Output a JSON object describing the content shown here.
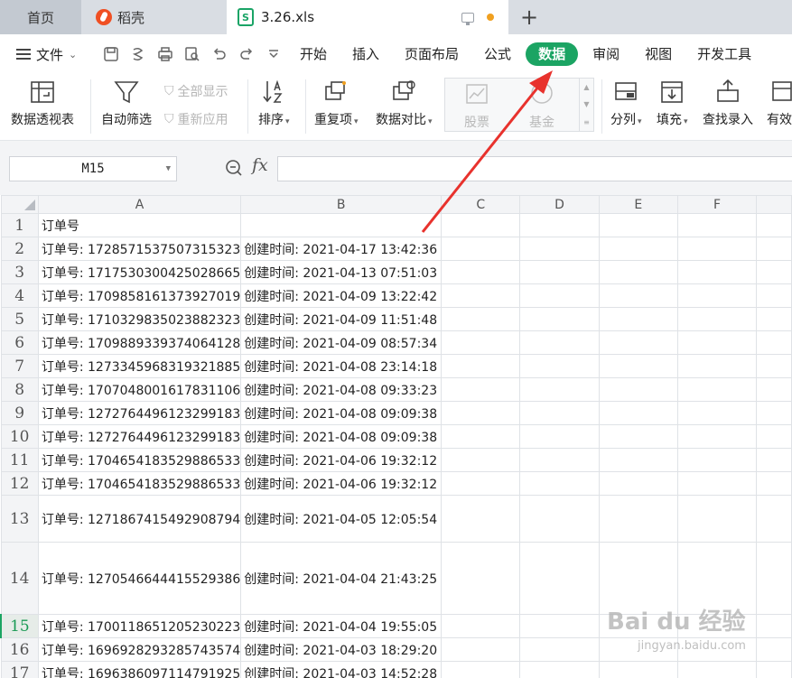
{
  "tabs": {
    "home": "首页",
    "docer": "稻壳",
    "file": "3.26.xls",
    "file_icon_letter": "S"
  },
  "menu": {
    "file_label": "文件",
    "tabs": [
      "开始",
      "插入",
      "页面布局",
      "公式",
      "数据",
      "审阅",
      "视图",
      "开发工具"
    ],
    "active_tab": "数据"
  },
  "ribbon": {
    "pivot": "数据透视表",
    "auto_filter": "自动筛选",
    "show_all": "全部显示",
    "reapply": "重新应用",
    "sort": "排序",
    "duplicates": "重复项",
    "compare": "数据对比",
    "stock": "股票",
    "fund": "基金",
    "split": "分列",
    "fill": "填充",
    "lookup": "查找录入",
    "valid": "有效"
  },
  "formula_bar": {
    "name_box": "M15",
    "fx_label": "fx",
    "formula": ""
  },
  "sheet": {
    "columns": [
      "A",
      "B",
      "C",
      "D",
      "E",
      "F"
    ],
    "rows": [
      {
        "n": "1",
        "a": "订单号",
        "b": ""
      },
      {
        "n": "2",
        "a": "订单号: 1728571537507315323",
        "b": "创建时间: 2021-04-17 13:42:36"
      },
      {
        "n": "3",
        "a": "订单号: 1717530300425028665",
        "b": "创建时间: 2021-04-13 07:51:03"
      },
      {
        "n": "4",
        "a": "订单号: 1709858161373927019",
        "b": "创建时间: 2021-04-09 13:22:42"
      },
      {
        "n": "5",
        "a": "订单号: 1710329835023882323",
        "b": "创建时间: 2021-04-09 11:51:48"
      },
      {
        "n": "6",
        "a": "订单号: 1709889339374064128",
        "b": "创建时间: 2021-04-09 08:57:34"
      },
      {
        "n": "7",
        "a": "订单号: 1273345968319321885",
        "b": "创建时间: 2021-04-08 23:14:18"
      },
      {
        "n": "8",
        "a": "订单号: 1707048001617831106",
        "b": "创建时间: 2021-04-08 09:33:23"
      },
      {
        "n": "9",
        "a": "订单号: 1272764496123299183",
        "b": "创建时间: 2021-04-08 09:09:38"
      },
      {
        "n": "10",
        "a": "订单号: 1272764496123299183",
        "b": "创建时间: 2021-04-08 09:09:38"
      },
      {
        "n": "11",
        "a": "订单号: 1704654183529886533",
        "b": "创建时间: 2021-04-06 19:32:12"
      },
      {
        "n": "12",
        "a": "订单号: 1704654183529886533",
        "b": "创建时间: 2021-04-06 19:32:12"
      },
      {
        "n": "13",
        "a": "订单号: 1271867415492908794",
        "b": "创建时间: 2021-04-05 12:05:54"
      },
      {
        "n": "14",
        "a": "订单号: 1270546644415529386",
        "b": "创建时间: 2021-04-04 21:43:25"
      },
      {
        "n": "15",
        "a": "订单号: 1700118651205230223",
        "b": "创建时间: 2021-04-04 19:55:05"
      },
      {
        "n": "16",
        "a": "订单号: 1696928293285743574",
        "b": "创建时间: 2021-04-03 18:29:20"
      },
      {
        "n": "17",
        "a": "订单号: 1696386097114791925",
        "b": "创建时间: 2021-04-03 14:52:28"
      }
    ]
  },
  "watermark": {
    "main": "Bai du 经验",
    "sub": "jingyan.baidu.com"
  },
  "colors": {
    "accent": "#1ba463",
    "arrow": "#e8322d"
  }
}
